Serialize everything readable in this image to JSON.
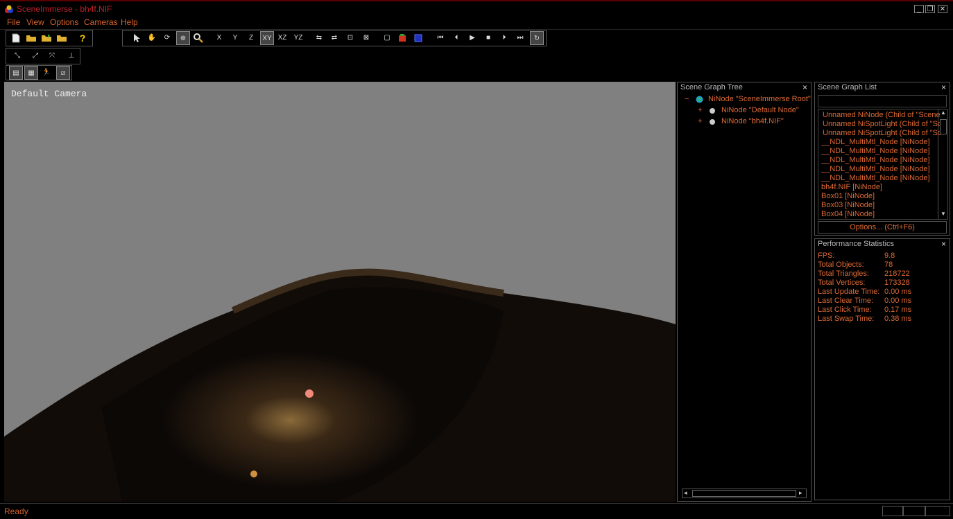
{
  "window": {
    "title": "SceneImmerse - bh4f.NIF",
    "minimize": "_",
    "restore": "❐",
    "close": "✕"
  },
  "menu": {
    "file": "File",
    "view": "View",
    "options": "Options",
    "cameras": "Cameras",
    "help": "Help"
  },
  "toolbar": {
    "x": "X",
    "y": "Y",
    "z": "Z",
    "xy": "XY",
    "xz": "XZ",
    "yz": "YZ"
  },
  "viewport": {
    "camera_label": "Default Camera"
  },
  "tree_panel": {
    "title": "Scene Graph Tree",
    "close": "×",
    "items": [
      {
        "sign": "−",
        "label": "NiNode \"SceneImmerse Root\""
      },
      {
        "sign": "+",
        "label": "NiNode \"Default Node\""
      },
      {
        "sign": "+",
        "label": "NiNode \"bh4f.NIF\""
      }
    ]
  },
  "list_panel": {
    "title": "Scene Graph List",
    "close": "×",
    "items": [
      " Unnamed NiNode (Child of \"Scene",
      " Unnamed NiSpotLight (Child of \"Sc",
      " Unnamed NiSpotLight (Child of \"Sc",
      "__NDL_MultiMtl_Node [NiNode]",
      "__NDL_MultiMtl_Node [NiNode]",
      "__NDL_MultiMtl_Node [NiNode]",
      "__NDL_MultiMtl_Node [NiNode]",
      "__NDL_MultiMtl_Node [NiNode]",
      "bh4f.NIF [NiNode]",
      "Box01 [NiNode]",
      "Box03 [NiNode]",
      "Box04 [NiNode]"
    ],
    "options_button": "Options... (Ctrl+F6)"
  },
  "stats_panel": {
    "title": "Performance Statistics",
    "close": "×",
    "rows": [
      {
        "label": "FPS:",
        "value": "9.8"
      },
      {
        "label": "Total Objects:",
        "value": "78"
      },
      {
        "label": "Total Triangles:",
        "value": "218722"
      },
      {
        "label": "Total Vertices:",
        "value": "173328"
      },
      {
        "label": "Last Update Time:",
        "value": "0.00 ms"
      },
      {
        "label": "Last Clear Time:",
        "value": "0.00 ms"
      },
      {
        "label": "Last Click Time:",
        "value": "0.17 ms"
      },
      {
        "label": "Last Swap Time:",
        "value": "0.38 ms"
      }
    ]
  },
  "status": {
    "text": "Ready"
  }
}
